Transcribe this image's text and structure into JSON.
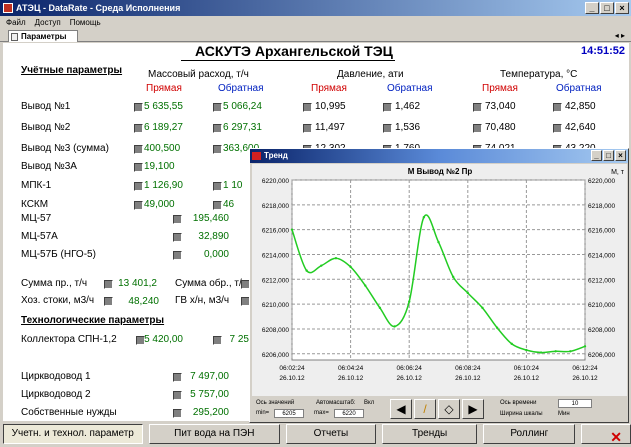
{
  "window": {
    "title": "АТЭЦ - DataRate - Среда Исполнения"
  },
  "menu": [
    "Файл",
    "Доступ",
    "Помощь"
  ],
  "tab": {
    "label": "Параметры",
    "arrows": "◂ ▸"
  },
  "header": {
    "title": "АСКУТЭ Архангельской ТЭЦ",
    "clock": "14:51:52"
  },
  "sections": {
    "accounting": "Учётные параметры",
    "tech": "Технологические параметры"
  },
  "columns": {
    "mass": "Массовый расход, т/ч",
    "pressure": "Давление, ати",
    "temp": "Температура, °С",
    "direct": "Прямая",
    "reverse": "Обратная"
  },
  "rows": [
    {
      "label": "Вывод №1",
      "m1": "5 635,55",
      "m2": "5 066,24",
      "p1": "10,995",
      "p2": "1,462",
      "t1": "73,040",
      "t2": "42,850"
    },
    {
      "label": "Вывод №2",
      "m1": "6 189,27",
      "m2": "6 297,31",
      "p1": "11,497",
      "p2": "1,536",
      "t1": "70,480",
      "t2": "42,640"
    },
    {
      "label": "Вывод №3 (сумма)",
      "m1": "400,500",
      "m2": "363,600",
      "p1": "12,302",
      "p2": "1,760",
      "t1": "74,021",
      "t2": "43,220"
    },
    {
      "label": "Вывод №3А",
      "m1": "19,100"
    },
    {
      "label": "МПК-1",
      "m1": "1 126,90",
      "m2": "1 10"
    },
    {
      "label": "КСКМ",
      "m1": "49,000",
      "m2": "46"
    }
  ],
  "mc_rows": [
    {
      "label": "МЦ-57",
      "v": "195,460"
    },
    {
      "label": "МЦ-57А",
      "v": "32,890"
    },
    {
      "label": "МЦ-57Б (НГО-5)",
      "v": "0,000"
    }
  ],
  "sums": {
    "direct_label": "Сумма пр., т/ч",
    "direct_val": "13 401,2",
    "reverse_label": "Сумма обр., т/ч",
    "drain_label": "Хоз. стоки, м3/ч",
    "drain_val": "48,240",
    "gv_label": "ГВ х/н, м3/ч"
  },
  "tech_rows": [
    {
      "label": "Коллектора СПН-1,2",
      "v1": "5 420,00",
      "v2": "7 25"
    }
  ],
  "lower_rows": [
    {
      "label": "Цирквodovod 1",
      "v": "7 497,00"
    },
    {
      "label": "Цирквodovod 2",
      "v": "5 757,00"
    },
    {
      "label": "Собственные нужды",
      "v": "295,200"
    }
  ],
  "bottom_buttons": [
    "Учетн. и технол. параметр",
    "Пит вода на ПЭН",
    "Отчеты",
    "Тренды",
    "Роллинг"
  ],
  "trend": {
    "title": "Тренд",
    "series_name": "М Вывод №2 Пр",
    "unit": "М, т",
    "controls": {
      "axis_values": "Ось значений",
      "auto": "Автомасштаб:",
      "on": "Вкл",
      "min_label": "min=",
      "min_val": "6205",
      "max_label": "max=",
      "max_val": "6220",
      "time_axis": "Ось времени",
      "scale_width": "Ширина шкалы",
      "scale_val": "10",
      "min_unit": "Мин"
    }
  },
  "chart_data": {
    "type": "line",
    "x": [
      "06:02:24",
      "06:02:54",
      "06:03:24",
      "06:03:54",
      "06:04:24",
      "06:04:54",
      "06:05:24",
      "06:05:54",
      "06:06:24",
      "06:06:54",
      "06:07:24",
      "06:07:54",
      "06:08:24",
      "06:08:54",
      "06:09:24",
      "06:09:54",
      "06:10:24",
      "06:10:54",
      "06:11:24",
      "06:11:54",
      "06:12:24"
    ],
    "values": [
      6216.0,
      6212.7,
      6213.1,
      6213.7,
      6213.0,
      6211.5,
      6209.7,
      6208.2,
      6210.2,
      6217.0,
      6215.0,
      6212.2,
      6210.9,
      6209.7,
      6208.1,
      6206.8,
      6206.3,
      6206.1,
      6206.2,
      6206.2,
      6206.6
    ],
    "x_ticks": [
      "06:02:24",
      "06:04:24",
      "06:06:24",
      "06:08:24",
      "06:10:24",
      "06:12:24"
    ],
    "x_dates": "26.10.12",
    "ylim": [
      6206,
      6220
    ],
    "y_ticks": [
      "6220,000",
      "6218,000",
      "6216,000",
      "6214,000",
      "6212,000",
      "6210,000",
      "6208,000",
      "6206,000"
    ],
    "series_color": "#22cc22",
    "grid": true
  }
}
